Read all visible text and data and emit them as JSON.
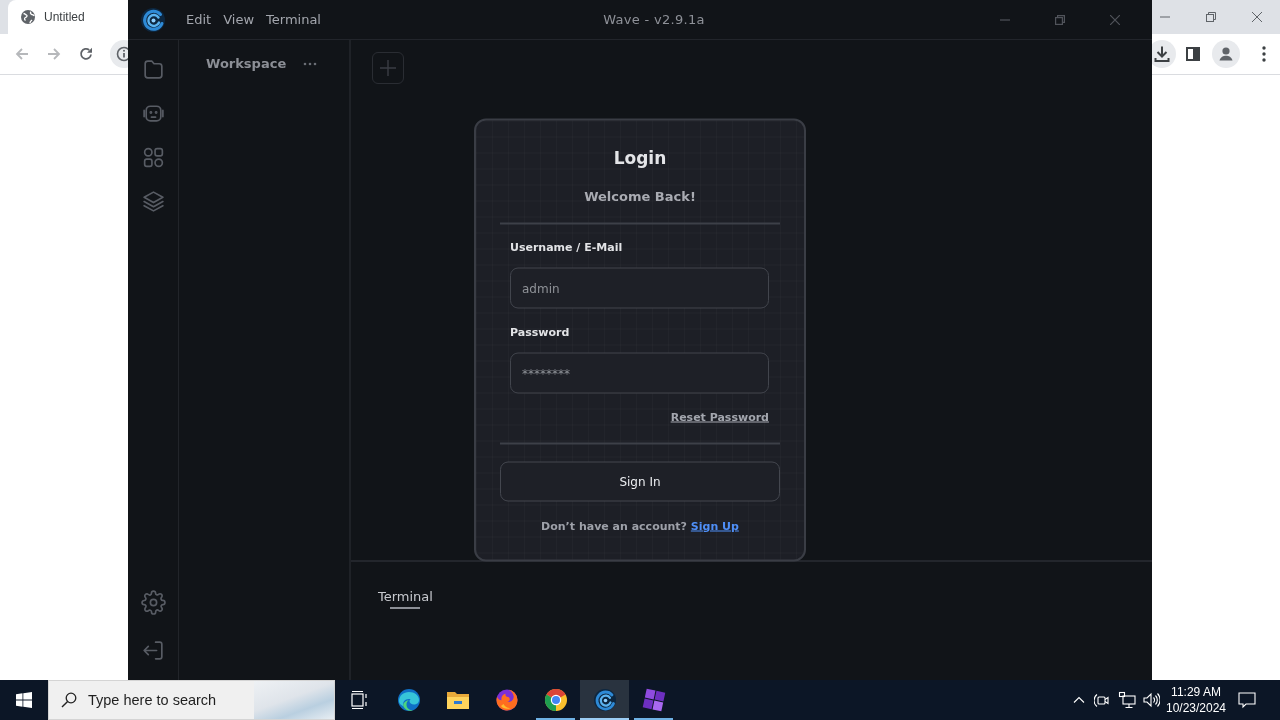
{
  "browser": {
    "tab": {
      "title": "Untitled"
    }
  },
  "app": {
    "menu": [
      "Edit",
      "View",
      "Terminal"
    ],
    "title": "Wave - v2.9.1a"
  },
  "sidebar": {
    "title": "Workspace"
  },
  "login": {
    "title": "Login",
    "subtitle": "Welcome Back!",
    "fields": [
      {
        "label": "Username / E-Mail",
        "placeholder": "admin"
      },
      {
        "label": "Password",
        "placeholder": "********"
      }
    ],
    "reset_link": "Reset Password",
    "submit": "Sign In",
    "signup_prompt": "Don’t have an account?",
    "signup_link": "Sign Up"
  },
  "terminal": {
    "tabs": [
      {
        "label": "Terminal",
        "selected": true
      }
    ]
  },
  "taskbar": {
    "search": {
      "placeholder": "Type here to search"
    },
    "apps": [
      {
        "kind": "edge",
        "running": false,
        "selected": false
      },
      {
        "kind": "explorer",
        "running": false,
        "selected": false
      },
      {
        "kind": "firefox",
        "running": false,
        "selected": false
      },
      {
        "kind": "chrome",
        "running": true,
        "selected": false
      },
      {
        "kind": "wave",
        "running": true,
        "selected": true
      },
      {
        "kind": "tiles",
        "running": true,
        "selected": false
      }
    ],
    "clock": {
      "time": "11:29 AM",
      "date": "10/23/2024"
    }
  }
}
